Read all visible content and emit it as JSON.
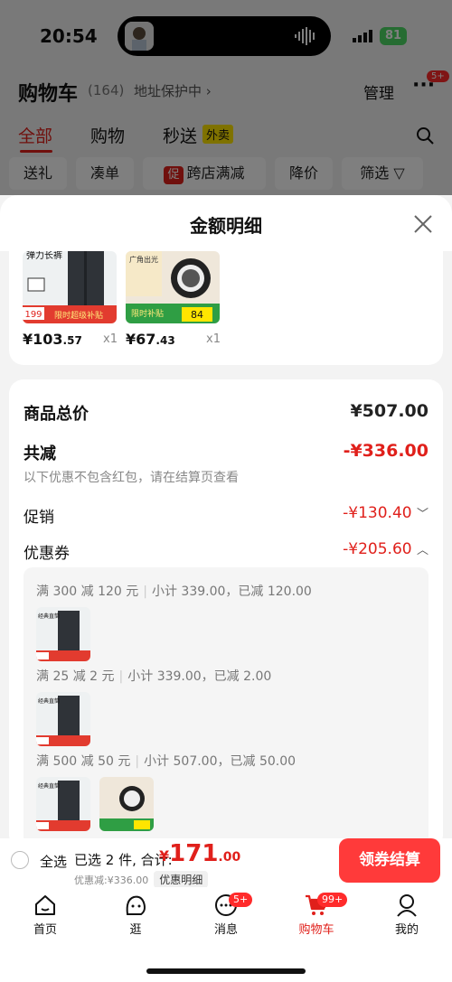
{
  "status": {
    "time": "20:54",
    "battery": "81"
  },
  "header": {
    "title": "购物车",
    "count": "(164)",
    "address": "地址保护中 ›",
    "manage": "管理",
    "more": "···",
    "more_badge": "5+"
  },
  "tabs": [
    {
      "label": "全部",
      "active": true
    },
    {
      "label": "购物"
    },
    {
      "label": "秒送"
    }
  ],
  "tab_tag": "外卖",
  "chips": [
    {
      "label": "送礼"
    },
    {
      "label": "凑单"
    },
    {
      "label": "跨店满减",
      "tag": "促"
    },
    {
      "label": "降价"
    },
    {
      "label": "筛选"
    }
  ],
  "sheet": {
    "title": "金额明细",
    "items": [
      {
        "price_int": "¥103",
        "price_dec": ".57",
        "qty": "x1",
        "thumb_badge": "199",
        "thumb_text": "限时超级补贴",
        "thumb_title": "弹力长裤"
      },
      {
        "price_int": "¥67",
        "price_dec": ".43",
        "qty": "x1",
        "thumb_text": "限时补贴",
        "thumb_sub": "84",
        "thumb_title": "广角出光"
      }
    ],
    "summary": {
      "total_label": "商品总价",
      "total_value": "¥507.00",
      "reduce_label": "共减",
      "reduce_value": "-¥336.00",
      "reduce_note": "以下优惠不包含红包，请在结算页查看",
      "promo_label": "促销",
      "promo_value": "-¥130.40",
      "coupon_label": "优惠券",
      "coupon_value": "-¥205.60"
    },
    "coupons": [
      {
        "rule": "满 300 减 120 元",
        "detail": "小计 339.00，已减 120.00"
      },
      {
        "rule": "满 25 减 2 元",
        "detail": "小计 339.00，已减 2.00"
      },
      {
        "rule": "满 500 减 50 元",
        "detail": "小计 507.00，已减 50.00"
      }
    ]
  },
  "checkout": {
    "select_all": "全选",
    "selected": "已选 2 件, 合计:",
    "sym": "¥",
    "total_int": "171",
    "total_dec": ".00",
    "discount": "优惠减:¥336.00",
    "detail_btn": "优惠明细",
    "pay": "领券结算"
  },
  "nav": [
    {
      "label": "首页",
      "icon": "home-icon"
    },
    {
      "label": "逛",
      "icon": "browse-icon"
    },
    {
      "label": "消息",
      "icon": "message-icon",
      "badge": "5+"
    },
    {
      "label": "购物车",
      "icon": "cart-icon",
      "badge": "99+",
      "active": true
    },
    {
      "label": "我的",
      "icon": "profile-icon"
    }
  ],
  "colors": {
    "accent": "#e0201b",
    "pay": "#ff3a3a"
  }
}
